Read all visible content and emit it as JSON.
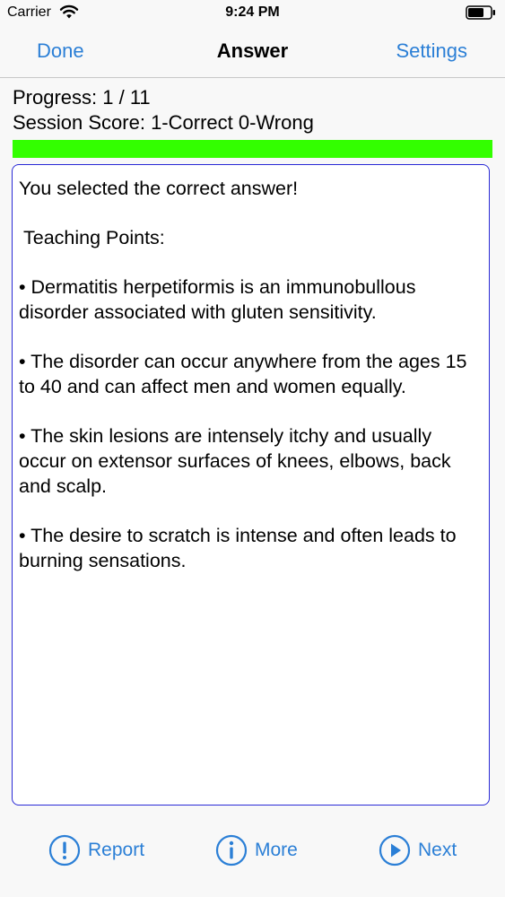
{
  "status_bar": {
    "carrier": "Carrier",
    "time": "9:24 PM",
    "wifi_icon": "wifi-icon",
    "battery_icon": "battery-icon"
  },
  "nav": {
    "left_label": "Done",
    "title": "Answer",
    "right_label": "Settings"
  },
  "progress": {
    "text": "Progress: 1 / 11",
    "score_text": "Session Score: 1-Correct 0-Wrong",
    "fill_fraction": 1.0,
    "fill_color": "#33ff00"
  },
  "answer": {
    "result": "You selected the correct answer!",
    "heading": "Teaching Points:",
    "points": [
      "• Dermatitis herpetiformis is an immunobullous disorder associated with gluten sensitivity.",
      "• The disorder can occur anywhere from the ages 15 to 40 and can affect men and women equally.",
      "• The skin lesions are intensely itchy and usually occur on extensor surfaces of knees, elbows, back and scalp.",
      "• The desire to scratch is intense and often leads to burning sensations."
    ]
  },
  "toolbar": {
    "report_label": "Report",
    "report_icon": "exclamation-circle-icon",
    "more_label": "More",
    "more_icon": "info-circle-icon",
    "next_label": "Next",
    "next_icon": "play-circle-icon"
  },
  "colors": {
    "accent": "#2b7fd6",
    "box_border": "#2a2ad6",
    "progress_fill": "#33ff00"
  }
}
